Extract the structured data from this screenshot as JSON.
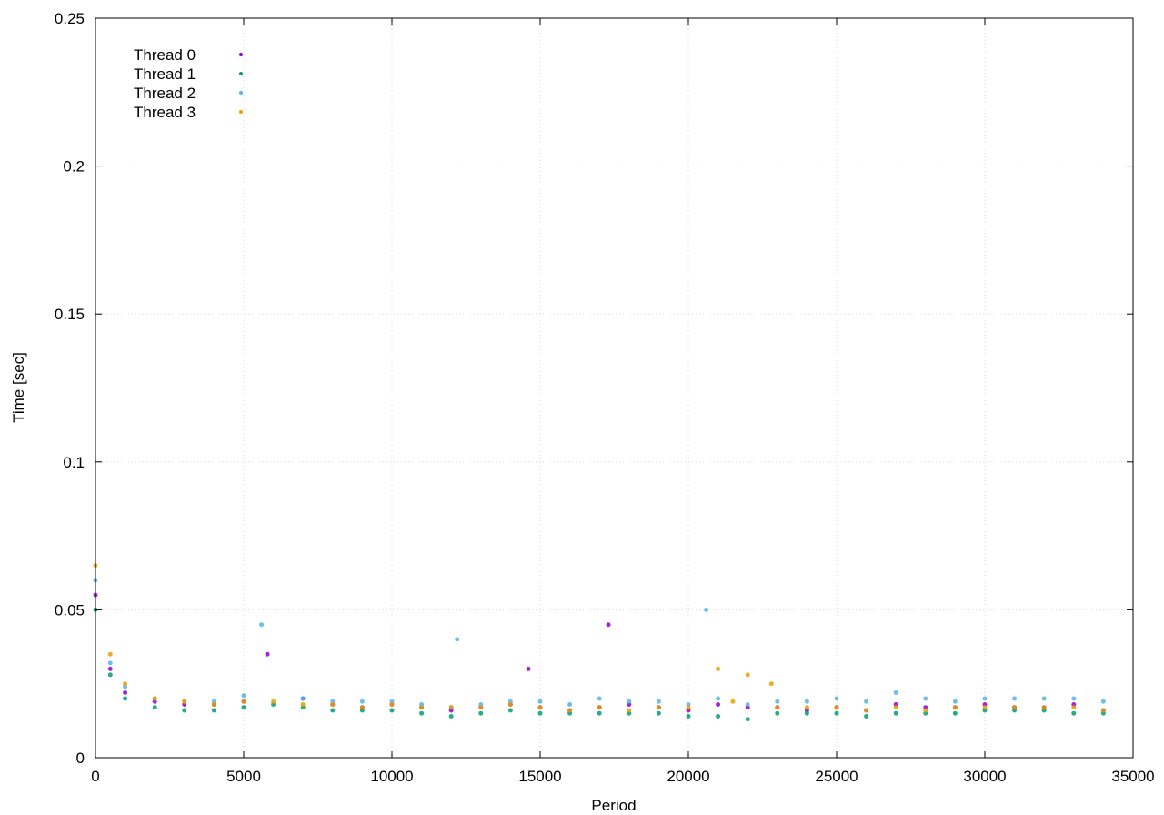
{
  "chart_data": {
    "type": "scatter",
    "title": "",
    "xlabel": "Period",
    "ylabel": "Time [sec]",
    "xlim": [
      0,
      35000
    ],
    "ylim": [
      0,
      0.25
    ],
    "xticks": [
      0,
      5000,
      10000,
      15000,
      20000,
      25000,
      30000,
      35000
    ],
    "xtick_labels": [
      "0",
      "5000",
      "10000",
      "15000",
      "20000",
      "25000",
      "30000",
      "35000"
    ],
    "yticks": [
      0,
      0.05,
      0.1,
      0.15,
      0.2,
      0.25
    ],
    "ytick_labels": [
      "0",
      "0.05",
      "0.1",
      "0.15",
      "0.2",
      "0.25"
    ],
    "grid": true,
    "legend_position": "top-left",
    "series": [
      {
        "name": "Thread 0",
        "color": "#9400d3",
        "x": [
          0,
          500,
          1000,
          2000,
          3000,
          4000,
          5000,
          5800,
          7000,
          8000,
          9000,
          10000,
          11000,
          12000,
          13000,
          14000,
          14600,
          15000,
          16000,
          17000,
          17300,
          18000,
          19000,
          20000,
          21000,
          22000,
          23000,
          24000,
          25000,
          26000,
          27000,
          28000,
          29000,
          30000,
          31000,
          32000,
          33000,
          34000
        ],
        "y": [
          0.055,
          0.03,
          0.022,
          0.019,
          0.018,
          0.018,
          0.019,
          0.035,
          0.02,
          0.018,
          0.017,
          0.018,
          0.017,
          0.016,
          0.017,
          0.018,
          0.03,
          0.017,
          0.016,
          0.017,
          0.045,
          0.018,
          0.017,
          0.016,
          0.018,
          0.017,
          0.017,
          0.016,
          0.017,
          0.016,
          0.018,
          0.017,
          0.017,
          0.018,
          0.017,
          0.017,
          0.018,
          0.016
        ]
      },
      {
        "name": "Thread 1",
        "color": "#009e73",
        "x": [
          0,
          500,
          1000,
          2000,
          3000,
          4000,
          5000,
          6000,
          7000,
          8000,
          9000,
          10000,
          11000,
          12000,
          13000,
          14000,
          15000,
          16000,
          17000,
          18000,
          19000,
          20000,
          21000,
          22000,
          23000,
          24000,
          25000,
          26000,
          27000,
          28000,
          29000,
          30000,
          31000,
          32000,
          33000,
          34000
        ],
        "y": [
          0.05,
          0.028,
          0.02,
          0.017,
          0.016,
          0.016,
          0.017,
          0.018,
          0.017,
          0.016,
          0.016,
          0.016,
          0.015,
          0.014,
          0.015,
          0.016,
          0.015,
          0.015,
          0.015,
          0.015,
          0.015,
          0.014,
          0.014,
          0.013,
          0.015,
          0.015,
          0.015,
          0.014,
          0.015,
          0.015,
          0.015,
          0.016,
          0.016,
          0.016,
          0.015,
          0.015
        ]
      },
      {
        "name": "Thread 2",
        "color": "#56b4e9",
        "x": [
          0,
          500,
          1000,
          2000,
          3000,
          4000,
          5000,
          5600,
          7000,
          8000,
          9000,
          10000,
          11000,
          12000,
          12200,
          13000,
          14000,
          15000,
          16000,
          17000,
          18000,
          19000,
          20000,
          20600,
          21000,
          22000,
          23000,
          24000,
          25000,
          26000,
          27000,
          28000,
          29000,
          30000,
          31000,
          32000,
          33000,
          34000
        ],
        "y": [
          0.06,
          0.032,
          0.024,
          0.02,
          0.019,
          0.019,
          0.021,
          0.045,
          0.02,
          0.019,
          0.019,
          0.019,
          0.018,
          0.017,
          0.04,
          0.018,
          0.019,
          0.019,
          0.018,
          0.02,
          0.019,
          0.019,
          0.018,
          0.05,
          0.02,
          0.018,
          0.019,
          0.019,
          0.02,
          0.019,
          0.022,
          0.02,
          0.019,
          0.02,
          0.02,
          0.02,
          0.02,
          0.019
        ]
      },
      {
        "name": "Thread 3",
        "color": "#e69f00",
        "x": [
          0,
          500,
          1000,
          2000,
          3000,
          4000,
          5000,
          6000,
          7000,
          8000,
          9000,
          10000,
          11000,
          12000,
          13000,
          14000,
          15000,
          16000,
          17000,
          18000,
          19000,
          20000,
          21000,
          21500,
          22000,
          22800,
          23000,
          24000,
          25000,
          26000,
          27000,
          28000,
          29000,
          30000,
          31000,
          32000,
          33000,
          34000
        ],
        "y": [
          0.065,
          0.035,
          0.025,
          0.02,
          0.019,
          0.018,
          0.019,
          0.019,
          0.018,
          0.018,
          0.017,
          0.018,
          0.017,
          0.017,
          0.017,
          0.018,
          0.017,
          0.016,
          0.017,
          0.016,
          0.017,
          0.017,
          0.03,
          0.019,
          0.028,
          0.025,
          0.017,
          0.017,
          0.017,
          0.016,
          0.017,
          0.016,
          0.017,
          0.017,
          0.017,
          0.017,
          0.017,
          0.016
        ]
      }
    ]
  }
}
